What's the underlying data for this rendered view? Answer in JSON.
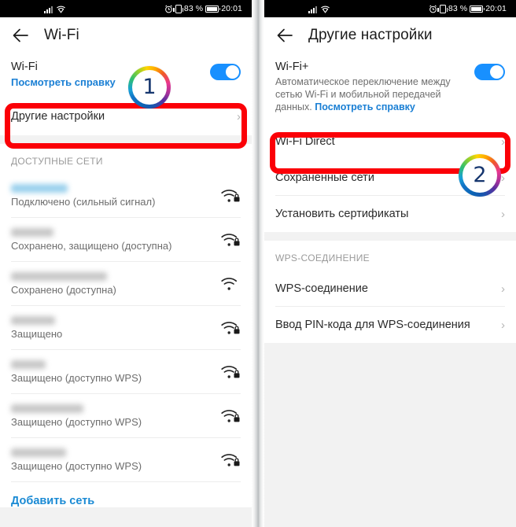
{
  "statusbar": {
    "signal_icon": "cellular-signal-icon",
    "wifi_icon": "wifi-icon",
    "alarm_icon": "alarm-clock-icon",
    "vibrate_icon": "vibrate-icon",
    "battery_percent": "83 %",
    "battery_icon": "battery-icon",
    "time": "20:01"
  },
  "left_screen": {
    "appbar": {
      "back_icon": "back-arrow-icon",
      "title": "Wi-Fi"
    },
    "wifi_master": {
      "label": "Wi-Fi",
      "help_link": "Посмотреть справку",
      "toggle_on": true
    },
    "more_settings_row": {
      "label": "Другие настройки",
      "chevron": "chevron-right-icon"
    },
    "section_header": "ДОСТУПНЫЕ СЕТИ",
    "networks": [
      {
        "ssid_hidden": true,
        "connected": true,
        "ssid_width": 72,
        "status": "Подключено (сильный сигнал)",
        "icon": "wifi-signal-lock-icon",
        "locked": true
      },
      {
        "ssid_hidden": true,
        "connected": false,
        "ssid_width": 54,
        "status": "Сохранено, защищено (доступна)",
        "icon": "wifi-signal-lock-icon",
        "locked": true
      },
      {
        "ssid_hidden": true,
        "connected": false,
        "ssid_width": 122,
        "status": "Сохранено (доступна)",
        "icon": "wifi-signal-icon",
        "locked": false
      },
      {
        "ssid_hidden": true,
        "connected": false,
        "ssid_width": 56,
        "status": "Защищено",
        "icon": "wifi-signal-lock-icon",
        "locked": true
      },
      {
        "ssid_hidden": true,
        "connected": false,
        "ssid_width": 44,
        "status": "Защищено (доступно WPS)",
        "icon": "wifi-signal-lock-icon",
        "locked": true
      },
      {
        "ssid_hidden": true,
        "connected": false,
        "ssid_width": 92,
        "status": "Защищено (доступно WPS)",
        "icon": "wifi-signal-lock-icon",
        "locked": true
      },
      {
        "ssid_hidden": true,
        "connected": false,
        "ssid_width": 70,
        "status": "Защищено (доступно WPS)",
        "icon": "wifi-signal-lock-icon",
        "locked": true
      }
    ],
    "add_network": "Добавить сеть",
    "badge": "1"
  },
  "right_screen": {
    "appbar": {
      "back_icon": "back-arrow-icon",
      "title": "Другие настройки"
    },
    "wifi_plus": {
      "label": "Wi-Fi+",
      "description": "Автоматическое переключение между сетью Wi-Fi и мобильной передачей данных. ",
      "help_link": "Посмотреть справку",
      "toggle_on": true
    },
    "rows": [
      {
        "label": "Wi-Fi Direct",
        "chevron": "chevron-right-icon"
      },
      {
        "label": "Сохраненные сети",
        "chevron": "chevron-right-icon"
      },
      {
        "label": "Установить сертификаты",
        "chevron": "chevron-right-icon"
      }
    ],
    "section_header": "WPS-СОЕДИНЕНИЕ",
    "wps_rows": [
      {
        "label": "WPS-соединение",
        "chevron": "chevron-right-icon"
      },
      {
        "label": "Ввод PIN-кода для WPS-соединения",
        "chevron": "chevron-right-icon"
      }
    ],
    "badge": "2"
  },
  "colors": {
    "accent_blue": "#1890ff",
    "link_blue": "#1a7fd4",
    "highlight_red": "#fb0007",
    "status_bar": "#000000"
  }
}
